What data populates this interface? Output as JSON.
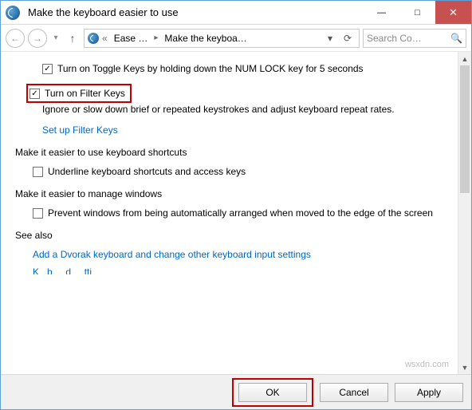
{
  "window": {
    "title": "Make the keyboard easier to use",
    "buttons": {
      "minimize": "—",
      "maximize": "□",
      "close": "✕"
    }
  },
  "breadcrumb": {
    "segments": [
      "Ease …",
      "Make the keyboa…"
    ],
    "search_placeholder": "Search Co…"
  },
  "content": {
    "toggle_keys": {
      "checked": true,
      "label": "Turn on Toggle Keys by holding down the NUM LOCK key for 5 seconds"
    },
    "filter_keys": {
      "checked": true,
      "label": "Turn on Filter Keys",
      "description": "Ignore or slow down brief or repeated keystrokes and adjust keyboard repeat rates.",
      "link": "Set up Filter Keys"
    },
    "section_shortcuts": {
      "title": "Make it easier to use keyboard shortcuts",
      "underline": {
        "checked": false,
        "label": "Underline keyboard shortcuts and access keys"
      }
    },
    "section_windows": {
      "title": "Make it easier to manage windows",
      "prevent": {
        "checked": false,
        "label": "Prevent windows from being automatically arranged when moved to the edge of the screen"
      }
    },
    "see_also": {
      "title": "See also",
      "links": [
        "Add a Dvorak keyboard and change other keyboard input settings"
      ]
    }
  },
  "buttons": {
    "ok": "OK",
    "cancel": "Cancel",
    "apply": "Apply"
  },
  "watermark": "wsxdn.com"
}
